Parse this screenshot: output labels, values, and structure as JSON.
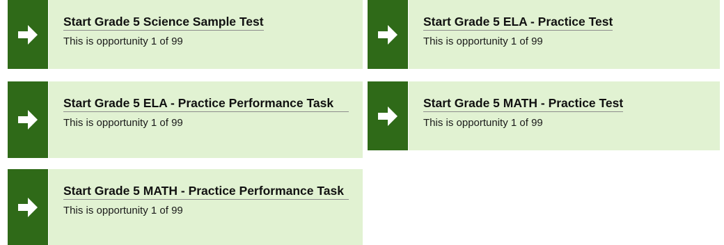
{
  "cards": [
    {
      "title": "Start Grade 5 Science Sample Test",
      "subtitle": "This is opportunity 1 of 99"
    },
    {
      "title": "Start Grade 5 ELA - Practice Test",
      "subtitle": "This is opportunity 1 of 99"
    },
    {
      "title": "Start Grade 5 ELA - Practice Performance Task",
      "subtitle": "This is opportunity 1 of 99"
    },
    {
      "title": "Start Grade 5 MATH - Practice Test",
      "subtitle": "This is opportunity 1 of 99"
    },
    {
      "title": "Start Grade 5 MATH - Practice Performance Task",
      "subtitle": "This is opportunity 1 of 99"
    }
  ],
  "icons": {
    "arrow": "right-arrow-icon"
  },
  "colors": {
    "arrow_bg": "#2f6a18",
    "card_bg": "#e1f2d2"
  }
}
